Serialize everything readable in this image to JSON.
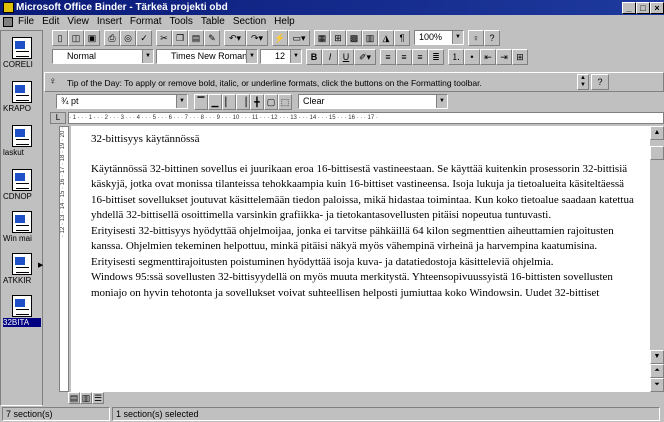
{
  "window": {
    "title": "Microsoft Office Binder - Tärkeä projekti obd",
    "min": "_",
    "max": "□",
    "close": "×"
  },
  "menu": [
    "File",
    "Edit",
    "View",
    "Insert",
    "Format",
    "Tools",
    "Table",
    "Section",
    "Help"
  ],
  "sections": [
    {
      "label": "CORELI",
      "selected": false
    },
    {
      "label": "KRAPO",
      "selected": false
    },
    {
      "label": "laskut",
      "selected": false
    },
    {
      "label": "CDNOP",
      "selected": false
    },
    {
      "label": "Win mai",
      "selected": false
    },
    {
      "label": "ATKKIR",
      "selected": false
    },
    {
      "label": "32BITA",
      "selected": true
    }
  ],
  "toolbar": {
    "style": "Normal",
    "font": "Times New Roman",
    "size": "12",
    "zoom": "100%",
    "bold": "B",
    "italic": "I",
    "underline": "U"
  },
  "tip": {
    "text": "Tip of the Day: To apply or remove bold, italic, or underline formats, click the buttons on the Formatting toolbar."
  },
  "borders": {
    "width": "¾ pt",
    "shading": "Clear"
  },
  "ruler": {
    "ticks": "· 1 · · · 1 · · · 2 · · · 3 · · · 4 · · · 5 · · · 6 · · · 7 · · · 8 · · · 9 · · · 10 · · · 11 · · · 12 · · · 13 · · · 14 · · · 15 · · · 16 · · · 17 ·",
    "vticks": "· 12 · 13 · 14 · 15 · 16 · 17 · 18 · 19 · 20 ·"
  },
  "document": {
    "heading": "32-bittisyys käytännössä",
    "paragraphs": [
      "Käytännössä 32-bittinen sovellus ei juurikaan eroa 16-bittisestä vastineestaan. Se käyttää kuitenkin prosessorin 32-bittisiä käskyjä, jotka ovat monissa tilanteissa tehokkaampia kuin 16-bittiset vastineensa. Isoja lukuja ja tietoalueita käsiteltäessä 16-bittiset sovellukset joutuvat käsittelemään tiedon paloissa, mikä hidastaa toimintaa. Kun koko tietoalue saadaan katettua yhdellä 32-bittisellä osoittimella varsinkin grafiikka- ja tietokantasovellusten pitäisi nopeutua tuntuvasti.",
      "  Erityisesti 32-bittisyys hyödyttää ohjelmoijaa, jonka ei tarvitse pähkäillä 64 kilon segmenttien aiheuttamien rajoitusten kanssa. Ohjelmien tekeminen helpottuu, minkä pitäisi näkyä myös vähempinä virheinä ja harvempina kaatumisina. Erityisesti segmenttirajoitusten poistuminen hyödyttää isoja kuva- ja datatiedostoja käsitteleviä ohjelmia.",
      "  Windows 95:ssä sovellusten 32-bittisyydellä on myös muuta merkitystä. Yhteensopivuussyistä 16-bittisten sovellusten moniajo on hyvin tehotonta ja sovellukset voivat suhteellisen helposti jumiuttaa koko Windowsin. Uudet 32-bittiset"
    ]
  },
  "status": {
    "sections": "7 section(s)",
    "selected": "1 section(s) selected"
  }
}
